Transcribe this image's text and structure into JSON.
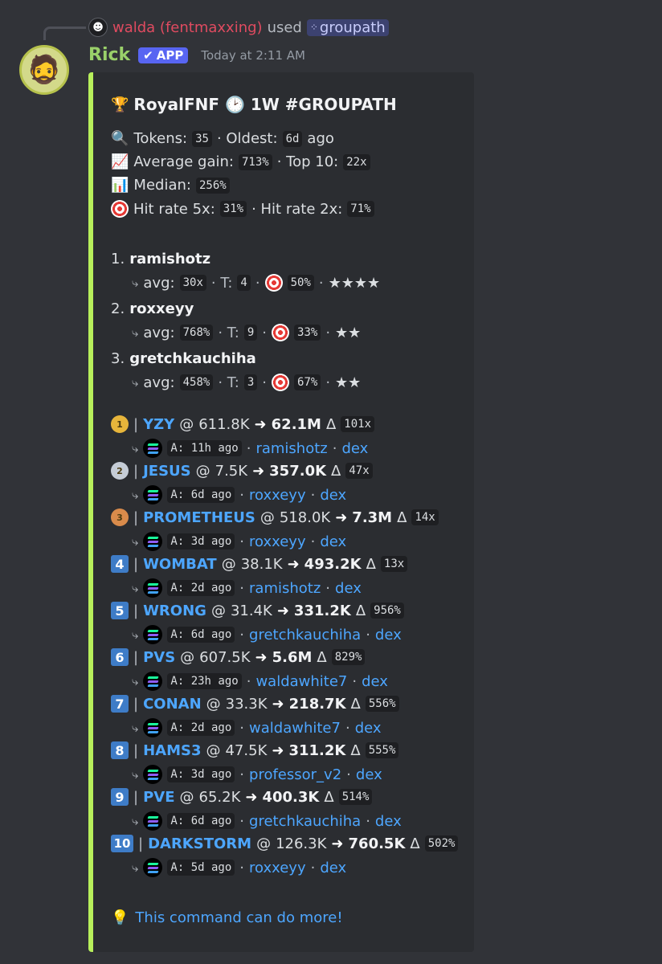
{
  "reply": {
    "user": "walda (fentmaxxing)",
    "used": "used",
    "command": "groupath"
  },
  "author": {
    "name": "Rick",
    "badge": "APP",
    "timestamp": "Today at 2:11 AM"
  },
  "embed": {
    "title": "RoyalFNF 🕑 1W #GROUPATH",
    "stats": {
      "tokens_label": "Tokens:",
      "tokens": "35",
      "oldest_label": "· Oldest:",
      "oldest": "6d",
      "oldest_suffix": "ago",
      "avg_label": "Average gain:",
      "avg": "713%",
      "top10_label": "· Top 10:",
      "top10": "22x",
      "median_label": "Median:",
      "median": "256%",
      "hit5_label": "Hit rate 5x:",
      "hit5": "31%",
      "hit2_label": "· Hit rate 2x:",
      "hit2": "71%"
    },
    "callers": [
      {
        "rank": "1.",
        "name": "ramishotz",
        "avg": "30x",
        "t": "4",
        "hit": "50%",
        "stars": "★★★★"
      },
      {
        "rank": "2.",
        "name": "roxxeyy",
        "avg": "768%",
        "t": "9",
        "hit": "33%",
        "stars": "★★"
      },
      {
        "rank": "3.",
        "name": "gretchkauchiha",
        "avg": "458%",
        "t": "3",
        "hit": "67%",
        "stars": "★★"
      }
    ],
    "labels": {
      "avg": "avg:",
      "t": "· T:",
      "sep": "·",
      "at": "@",
      "delta": "Δ",
      "a": "A:",
      "dex": "dex",
      "bar": "|",
      "arrow": "➜"
    },
    "tokens": [
      {
        "rank": "1",
        "name": "YZY",
        "from": "611.8K",
        "to": "62.1M",
        "mult": "101x",
        "ago": "11h ago",
        "caller": "ramishotz"
      },
      {
        "rank": "2",
        "name": "JESUS",
        "from": "7.5K",
        "to": "357.0K",
        "mult": "47x",
        "ago": "6d ago",
        "caller": "roxxeyy"
      },
      {
        "rank": "3",
        "name": "PROMETHEUS",
        "from": "518.0K",
        "to": "7.3M",
        "mult": "14x",
        "ago": "3d ago",
        "caller": "roxxeyy"
      },
      {
        "rank": "4",
        "name": "WOMBAT",
        "from": "38.1K",
        "to": "493.2K",
        "mult": "13x",
        "ago": "2d ago",
        "caller": "ramishotz"
      },
      {
        "rank": "5",
        "name": "WRONG",
        "from": "31.4K",
        "to": "331.2K",
        "mult": "956%",
        "ago": "6d ago",
        "caller": "gretchkauchiha"
      },
      {
        "rank": "6",
        "name": "PVS",
        "from": "607.5K",
        "to": "5.6M",
        "mult": "829%",
        "ago": "23h ago",
        "caller": "waldawhite7"
      },
      {
        "rank": "7",
        "name": "CONAN",
        "from": "33.3K",
        "to": "218.7K",
        "mult": "556%",
        "ago": "2d ago",
        "caller": "waldawhite7"
      },
      {
        "rank": "8",
        "name": "HAMS3",
        "from": "47.5K",
        "to": "311.2K",
        "mult": "555%",
        "ago": "3d ago",
        "caller": "professor_v2"
      },
      {
        "rank": "9",
        "name": "PVE",
        "from": "65.2K",
        "to": "400.3K",
        "mult": "514%",
        "ago": "6d ago",
        "caller": "gretchkauchiha"
      },
      {
        "rank": "10",
        "name": "DARKSTORM",
        "from": "126.3K",
        "to": "760.5K",
        "mult": "502%",
        "ago": "5d ago",
        "caller": "roxxeyy"
      }
    ],
    "footer": "This command can do more!"
  }
}
